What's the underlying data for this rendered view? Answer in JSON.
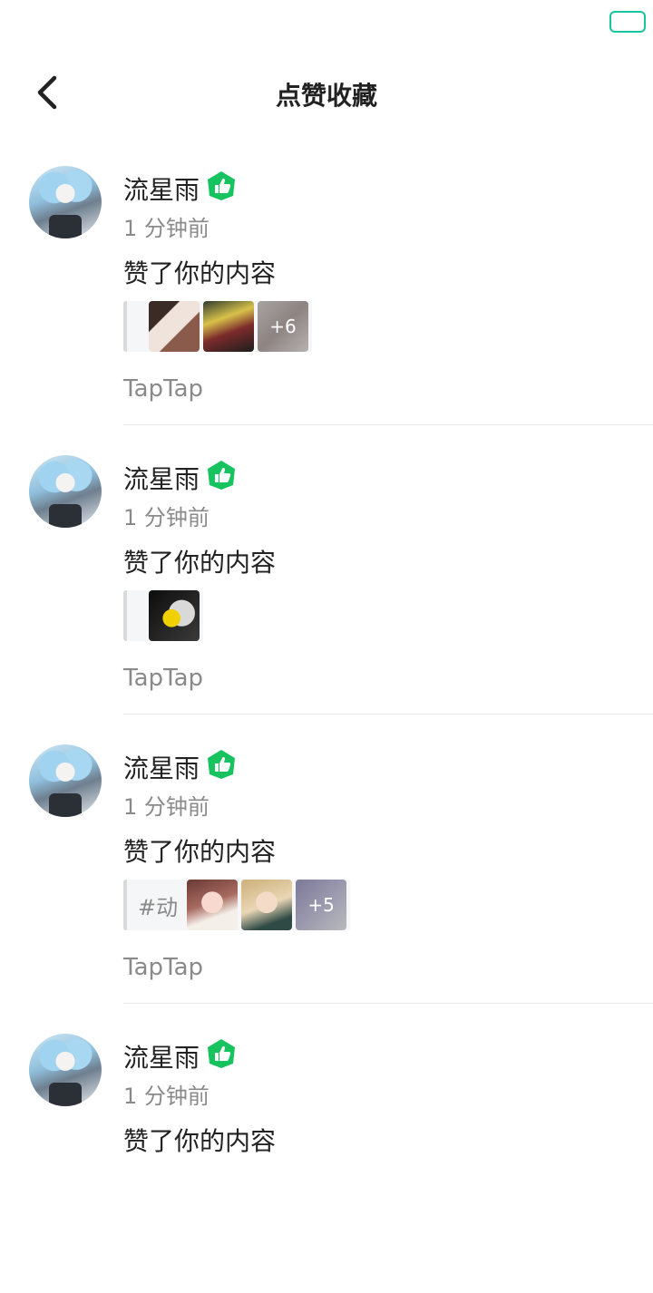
{
  "header": {
    "title": "点赞收藏",
    "back_icon": "chevron-left-icon"
  },
  "status_bar": {
    "battery_icon": "battery-icon",
    "accent": "#15c5a0"
  },
  "notifications": [
    {
      "username": "流星雨",
      "time": "1 分钟前",
      "action": "赞了你的内容",
      "tag": "",
      "more_count": "+6",
      "source": "TapTap"
    },
    {
      "username": "流星雨",
      "time": "1 分钟前",
      "action": "赞了你的内容",
      "tag": "",
      "more_count": "",
      "source": "TapTap"
    },
    {
      "username": "流星雨",
      "time": "1 分钟前",
      "action": "赞了你的内容",
      "tag": "#动",
      "more_count": "+5",
      "source": "TapTap"
    },
    {
      "username": "流星雨",
      "time": "1 分钟前",
      "action": "赞了你的内容"
    }
  ],
  "colors": {
    "badge_green": "#16c35f",
    "secondary_text": "#8a8a8a"
  }
}
